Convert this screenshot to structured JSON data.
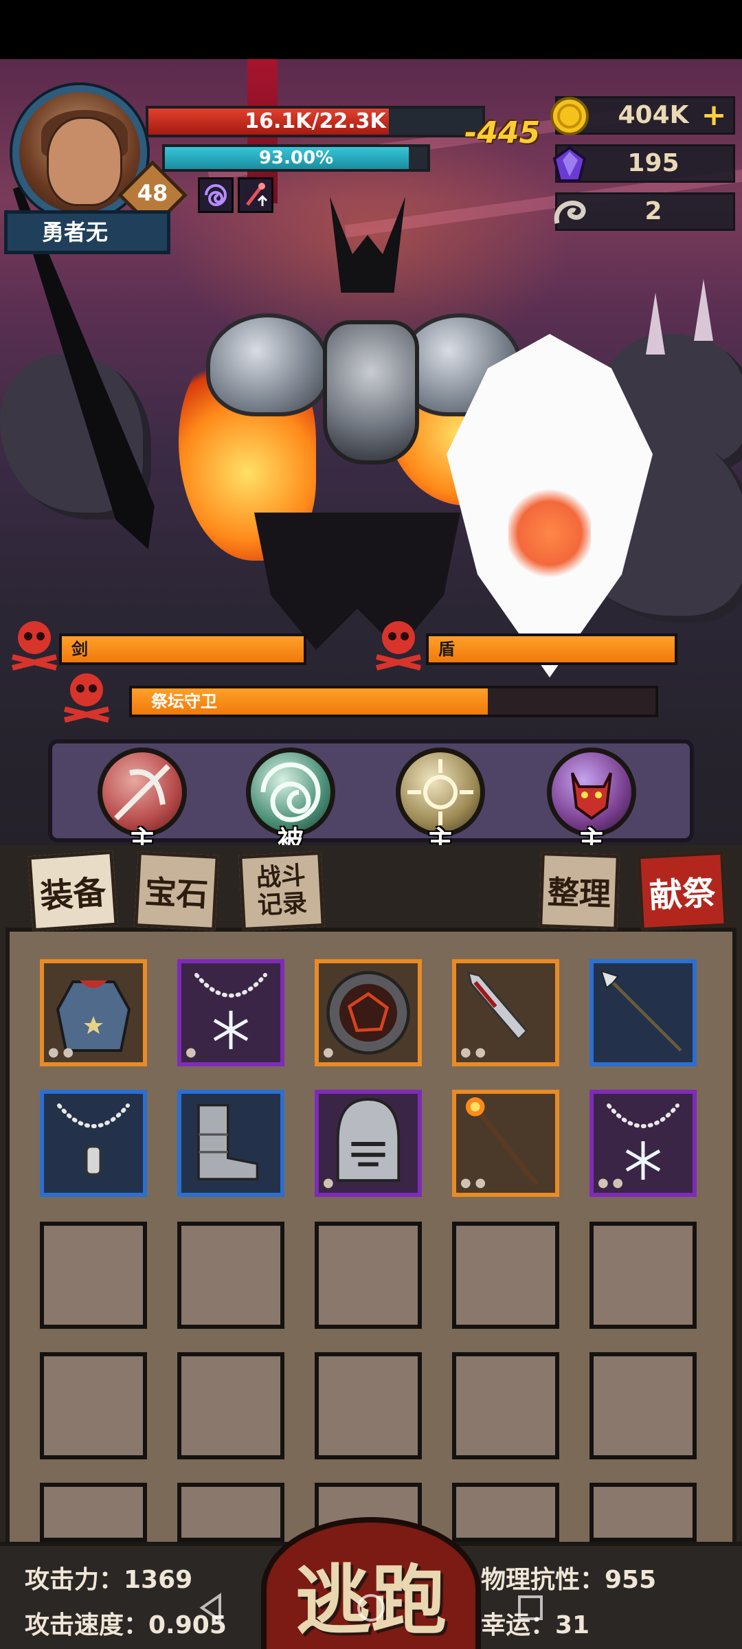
{
  "hero": {
    "name": "勇者无",
    "level": "48",
    "hp_text": "16.1K/22.3K",
    "hp_fraction": 0.72,
    "mp_text": "93.00%",
    "mp_fraction": 0.93,
    "buffs": [
      "vortex-buff-icon",
      "staff-upgrade-buff-icon"
    ]
  },
  "damage_popup": "-445",
  "currency": {
    "gold": "404K",
    "crystal": "195",
    "horn": "2"
  },
  "enemies": [
    {
      "name": "剑",
      "fraction": 1.0
    },
    {
      "name": "盾",
      "fraction": 1.0
    },
    {
      "name": "祭坛守卫",
      "fraction": 0.68
    }
  ],
  "skills": [
    {
      "icon": "crossbow-skill-icon",
      "tag": "主",
      "color": "#b64a4a"
    },
    {
      "icon": "vortex-skill-icon",
      "tag": "被",
      "color": "#4a8f76"
    },
    {
      "icon": "sun-skill-icon",
      "tag": "主",
      "color": "#9d8a55"
    },
    {
      "icon": "demon-mask-skill-icon",
      "tag": "主",
      "color": "#7a3f8f"
    }
  ],
  "tabs": {
    "equipment": "装备",
    "gems": "宝石",
    "battle_log": "战斗记录",
    "sort": "整理",
    "sacrifice": "献祭"
  },
  "inventory": [
    {
      "icon": "coat-armor-icon",
      "rarity": "orange"
    },
    {
      "icon": "snowflake-necklace-icon",
      "rarity": "purple"
    },
    {
      "icon": "lava-shield-icon",
      "rarity": "orange"
    },
    {
      "icon": "bloody-dagger-icon",
      "rarity": "orange"
    },
    {
      "icon": "spear-icon",
      "rarity": "blue"
    },
    {
      "icon": "pendant-necklace-icon",
      "rarity": "blue"
    },
    {
      "icon": "iron-boots-icon",
      "rarity": "blue"
    },
    {
      "icon": "knight-helmet-icon",
      "rarity": "purple"
    },
    {
      "icon": "fire-staff-icon",
      "rarity": "orange"
    },
    {
      "icon": "snowflake-necklace-icon",
      "rarity": "purple"
    }
  ],
  "stats": {
    "attack": "攻击力：1369",
    "attack_speed": "攻击速度：0.905",
    "phys_res": "物理抗性：955",
    "luck": "幸运：31"
  },
  "flee_label": "逃跑"
}
